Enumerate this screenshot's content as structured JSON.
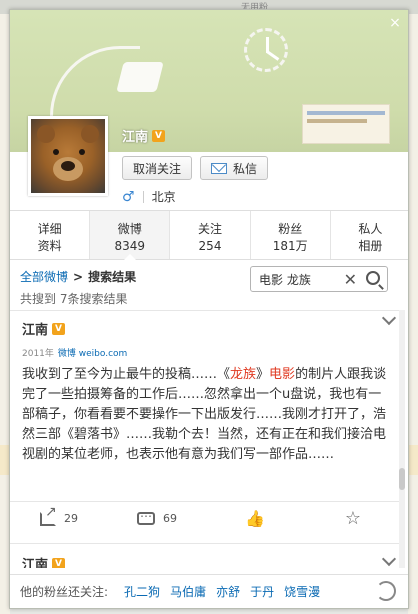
{
  "background": {
    "top_text": "无用粉"
  },
  "profile": {
    "name": "江南",
    "verified_badge": "V",
    "unfollow_label": "取消关注",
    "message_label": "私信",
    "gender_icon": "♂",
    "location": "北京"
  },
  "tabs": [
    {
      "line1": "详细",
      "line2": "资料"
    },
    {
      "line1": "微博",
      "line2": "8349"
    },
    {
      "line1": "关注",
      "line2": "254"
    },
    {
      "line1": "粉丝",
      "line2": "181万"
    },
    {
      "line1": "私人",
      "line2": "相册"
    }
  ],
  "breadcrumb": {
    "root": "全部微博",
    "sep": ">",
    "current": "搜索结果"
  },
  "results": {
    "summary": "共搜到 7条搜索结果"
  },
  "search": {
    "value": "电影 龙族"
  },
  "post": {
    "name": "江南",
    "badge": "V",
    "year": "2011年",
    "source": "微博 weibo.com",
    "text_before": "我收到了至今为止最牛的投稿……《",
    "hl1": "龙族",
    "text_mid": "》",
    "hl2": "电影",
    "text_after": "的制片人跟我谈完了一些拍摄筹备的工作后……忽然拿出一个u盘说，我也有一部稿子，你看看要不要操作一下出版发行……我刚才打开了，浩然三部《碧落书》……我勒个去！当然，还有正在和我们接洽电视剧的某位老师，也表示他有意为我们写一部作品……",
    "share_count": "29",
    "comment_count": "69"
  },
  "post2": {
    "name": "江南",
    "badge": "V"
  },
  "follow": {
    "label": "他的粉丝还关注:",
    "names": [
      "孔二狗",
      "马伯庸",
      "亦舒",
      "于丹",
      "饶雪漫"
    ]
  },
  "colors": {
    "link": "#0a6ab3",
    "highlight": "#e03a22",
    "badge": "#f2a31c"
  }
}
